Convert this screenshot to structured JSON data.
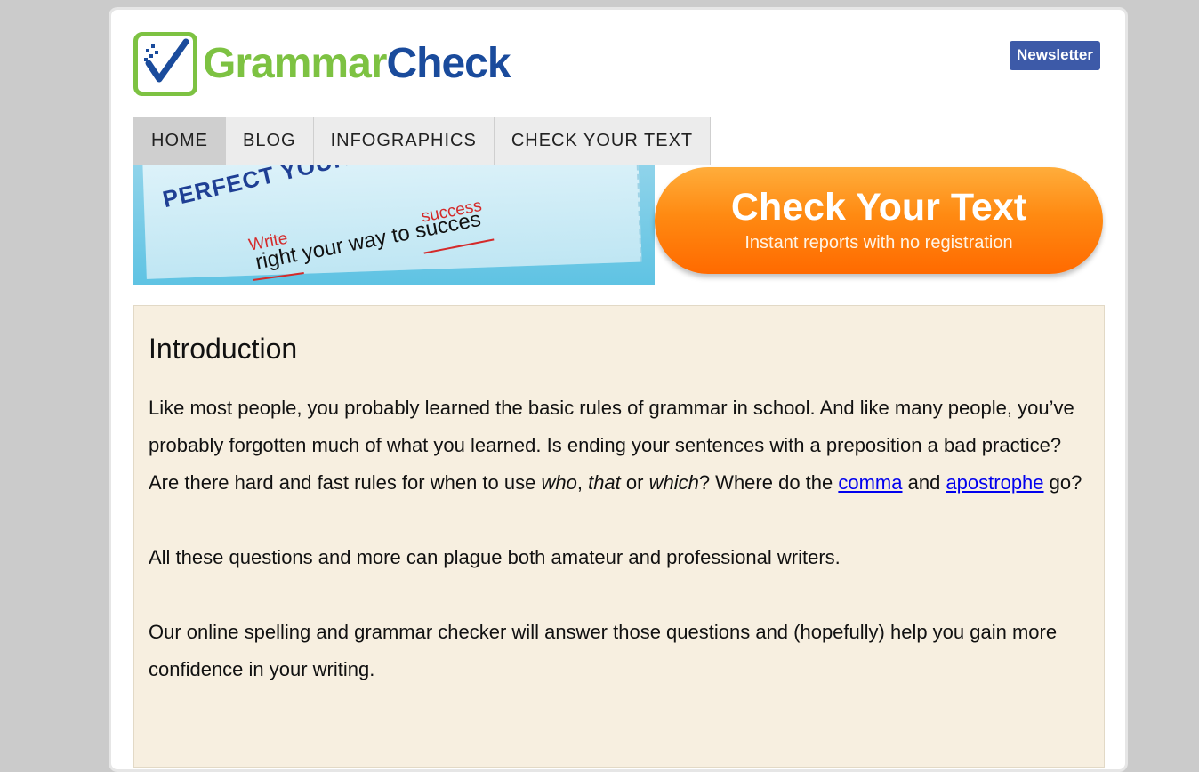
{
  "logo": {
    "part1": "Grammar",
    "part2": "Check"
  },
  "newsletter": {
    "label": "Newsletter"
  },
  "nav": {
    "items": [
      "HOME",
      "BLOG",
      "INFOGRAPHICS",
      "CHECK YOUR TEXT"
    ],
    "active": "HOME"
  },
  "banner": {
    "headline": "PERFECT YOUR WRITING!",
    "correction_write": "Write",
    "correction_success": "success",
    "line": "right your way to succes",
    "cta_title": "Check Your Text",
    "cta_subtitle": "Instant reports with no registration"
  },
  "intro": {
    "heading": "Introduction",
    "p1_a": "Like most people, you probably learned the basic rules of grammar in school. And like many people, you’ve probably forgotten much of what you learned. Is ending your sentences with a preposition a bad practice? Are there hard and fast rules for when to use ",
    "p1_who": "who",
    "p1_comma_sep": ", ",
    "p1_that": "that",
    "p1_or": " or ",
    "p1_which": "which",
    "p1_b": "? Where do the ",
    "link_comma": "comma",
    "p1_and": " and ",
    "link_apostrophe": "apostrophe",
    "p1_end": " go?",
    "p2": "All these questions and more can plague both amateur and professional writers.",
    "p3": "Our online spelling and grammar checker will answer those questions and (hopefully) help you gain more confidence in your writing."
  },
  "colors": {
    "logo_green": "#7dc242",
    "logo_blue": "#1a4b9c",
    "newsletter_bg": "#3d5aa8",
    "cta_orange": "#ff8a12",
    "content_bg": "#f7efe0"
  }
}
